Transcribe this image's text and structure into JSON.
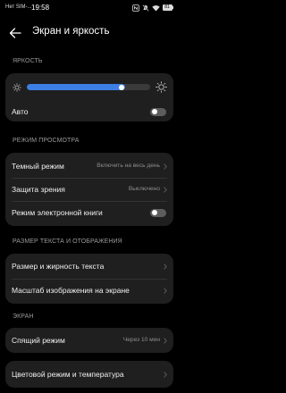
{
  "status_bar": {
    "carrier": "Нет SIM-...",
    "time": "19:58",
    "battery_level": "81"
  },
  "header": {
    "title": "Экран и яркость"
  },
  "brightness": {
    "section_title": "ЯРКОСТЬ",
    "level": 0.8,
    "auto_label": "Авто",
    "auto_enabled": false
  },
  "view_mode": {
    "section_title": "РЕЖИМ ПРОСМОТРА",
    "dark_mode_label": "Темный режим",
    "dark_mode_value": "Включить на весь день",
    "eye_comfort_label": "Защита зрения",
    "eye_comfort_value": "Выключено",
    "ebook_mode_label": "Режим электронной книги",
    "ebook_mode_enabled": false
  },
  "text_display": {
    "section_title": "РАЗМЕР ТЕКСТА И ОТОБРАЖЕНИЯ",
    "text_size_label": "Размер и жирность текста",
    "display_scale_label": "Масштаб изображения на экране"
  },
  "screen": {
    "section_title": "ЭКРАН",
    "sleep_label": "Спящий режим",
    "sleep_value": "Через 10 мин",
    "color_mode_label": "Цветовой режим и температура"
  },
  "colors": {
    "accent": "#3e7fe6",
    "card": "#1f1f1f",
    "background": "#000000",
    "secondary_text": "#8d8d8d"
  }
}
